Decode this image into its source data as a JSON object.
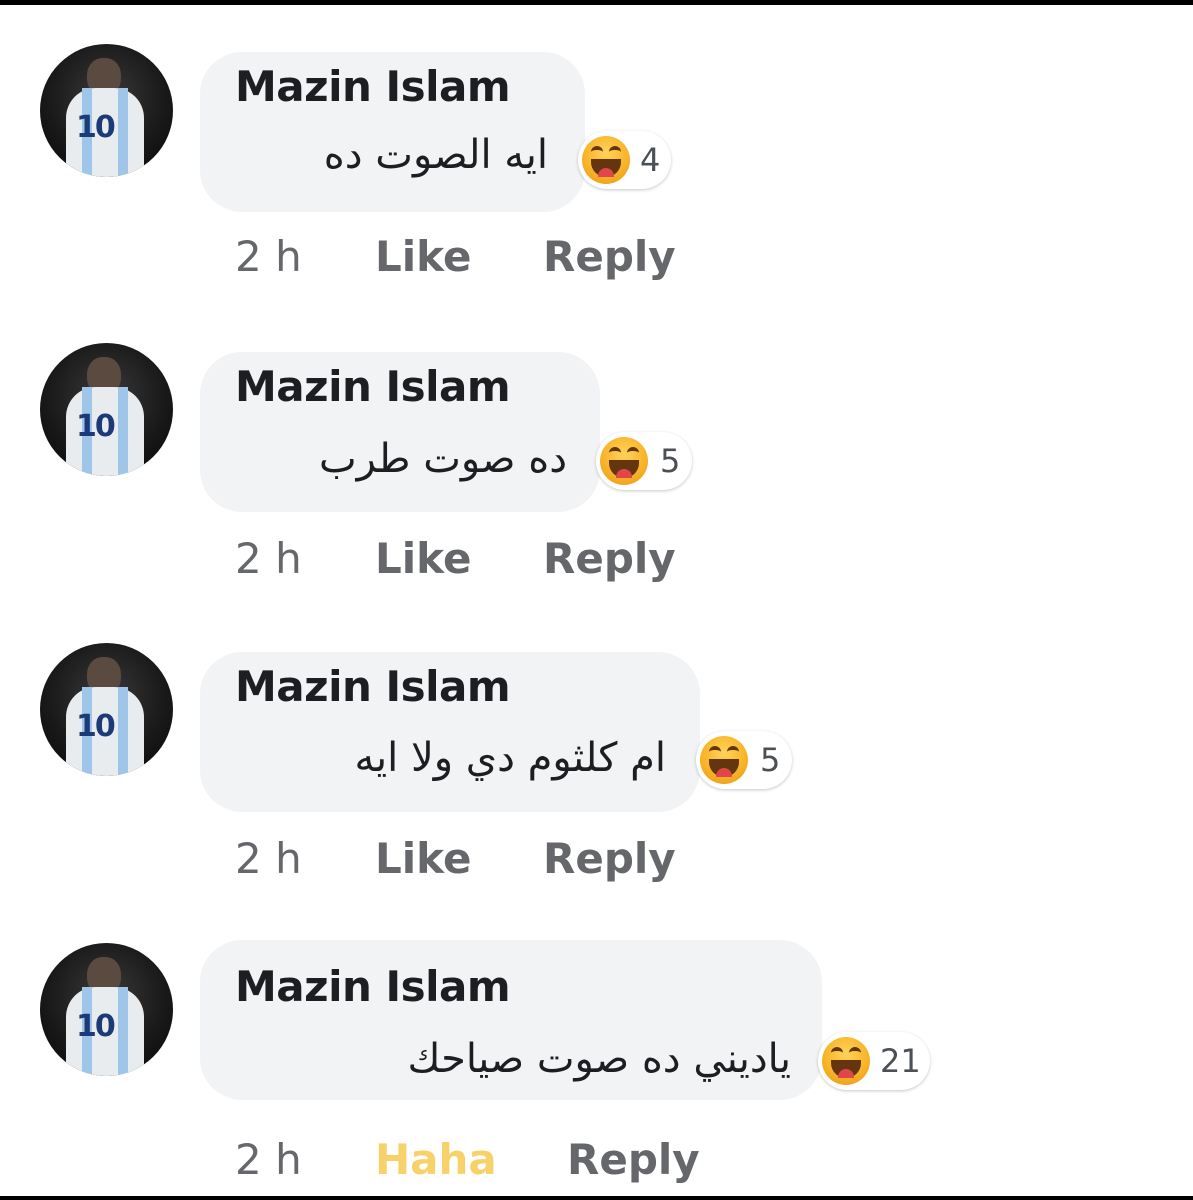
{
  "comments": [
    {
      "author": "Mazin Islam",
      "text": "ايه الصوت ده",
      "reaction_icon": "haha-emoji",
      "reaction_count": "4",
      "time": "2 h",
      "action": "Like",
      "reply": "Reply"
    },
    {
      "author": "Mazin Islam",
      "text": "ده صوت طرب",
      "reaction_icon": "haha-emoji",
      "reaction_count": "5",
      "time": "2 h",
      "action": "Like",
      "reply": "Reply"
    },
    {
      "author": "Mazin Islam",
      "text": "ام كلثوم دي ولا ايه",
      "reaction_icon": "haha-emoji",
      "reaction_count": "5",
      "time": "2 h",
      "action": "Like",
      "reply": "Reply"
    },
    {
      "author": "Mazin Islam",
      "text": "ياديني ده صوت صياحك",
      "reaction_icon": "haha-emoji",
      "reaction_count": "21",
      "time": "2 h",
      "action": "Haha",
      "reply": "Reply"
    }
  ],
  "colors": {
    "bubble": "#f2f3f5",
    "meta_text": "#65676b",
    "haha_active": "#f7d26b",
    "emoji": "#f7b125"
  }
}
